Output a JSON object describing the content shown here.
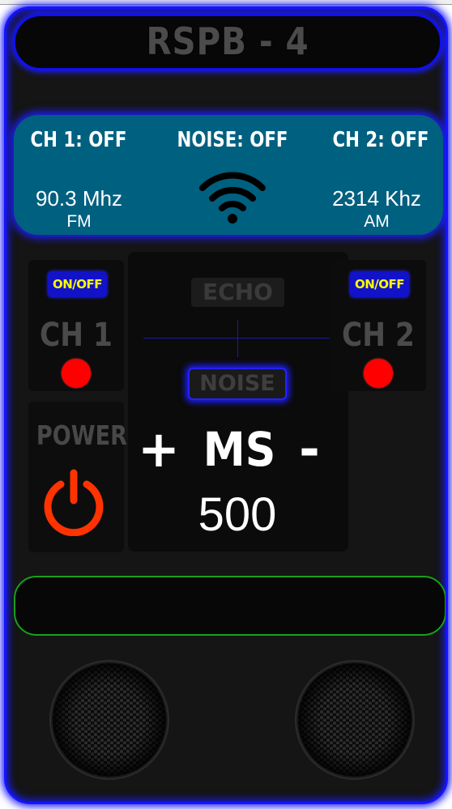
{
  "device": {
    "title": "RSPB - 4"
  },
  "info_panel": {
    "ch1_status": "CH 1: OFF",
    "noise_status": "NOISE: OFF",
    "ch2_status": "CH 2: OFF",
    "ch1_frequency": "90.3 Mhz",
    "ch1_band": "FM",
    "ch2_frequency": "2314 Khz",
    "ch2_band": "AM",
    "signal_icon": "wifi-signal-icon"
  },
  "channel_1": {
    "toggle_label": "ON/OFF",
    "label": "CH 1",
    "indicator_color": "#ff0000"
  },
  "channel_2": {
    "toggle_label": "ON/OFF",
    "label": "CH 2",
    "indicator_color": "#ff0000"
  },
  "effects": {
    "echo_label": "ECHO",
    "noise_label": "NOISE"
  },
  "power": {
    "label": "POWER",
    "icon": "power-icon",
    "icon_color": "#ff3300"
  },
  "ms_control": {
    "increment_label": "+",
    "label": "MS",
    "decrement_label": "-",
    "value": "500"
  },
  "colors": {
    "frame_glow": "#1414ff",
    "info_panel": "#006080",
    "toggle_text": "#ffff00",
    "display_border": "#19a019"
  }
}
